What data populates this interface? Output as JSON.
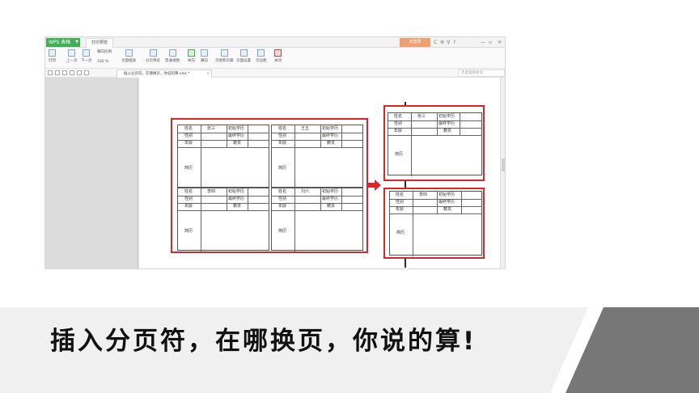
{
  "window": {
    "app_name": "WPS 表格",
    "active_tab": "打印预览",
    "login": "未登录",
    "title_icons": [
      "C",
      "⚙",
      "♀",
      "?",
      "—",
      "▫",
      "✕"
    ]
  },
  "ribbon": {
    "print": "打印",
    "prev_page": "上一页",
    "next_page": "下一页",
    "scale_label": "横向比例",
    "scale_value": "100 %",
    "page_zoom": "页面缩放",
    "pagebreak_preview": "分页预览",
    "normal_view": "普通视图",
    "portrait": "纵向",
    "landscape": "横向",
    "header_footer": "页眉和页脚",
    "page_setup": "页面设置",
    "margins": "页边距",
    "close": "关闭"
  },
  "docbar": {
    "tab_title": "插入分页符，在哪换页，你说的算.xlsx *",
    "search_placeholder": "点此查找命令"
  },
  "form": {
    "name_label": "姓名",
    "gender_label": "性别",
    "age_label": "年龄",
    "resume_label": "简历",
    "initial_edu": "初始学历",
    "highest_edu": "最终学历",
    "origin": "籍贯",
    "persons": [
      "张三",
      "王五",
      "李四",
      "刘六"
    ]
  },
  "caption": "插入分页符，在哪换页，你说的算!",
  "colors": {
    "accent": "#3fae55",
    "highlight": "#d9262b",
    "login": "#f0a070"
  }
}
